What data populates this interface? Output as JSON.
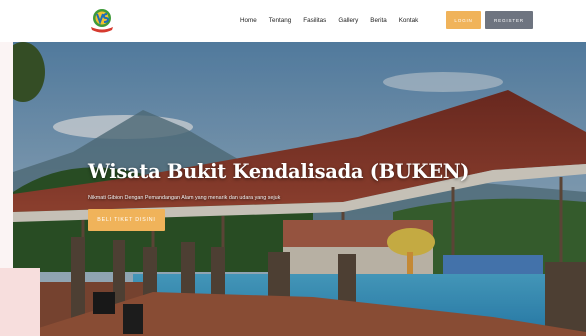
{
  "navbar": {
    "links": [
      "Home",
      "Tentang",
      "Fasilitas",
      "Gallery",
      "Berita",
      "Kontak"
    ],
    "login_label": "LOGIN",
    "register_label": "REGISTER"
  },
  "hero": {
    "title": "Wisata Bukit Kendalisada (BUKEN)",
    "subtitle": "Nikmati Gibion Dengan Pemandangan Alam yang menarik dan udara yang sejuk",
    "cta_label": "BELI TIKET DISINI"
  },
  "colors": {
    "accent": "#f0b35a",
    "register": "#6e7480",
    "roof": "#8b3a2b"
  }
}
